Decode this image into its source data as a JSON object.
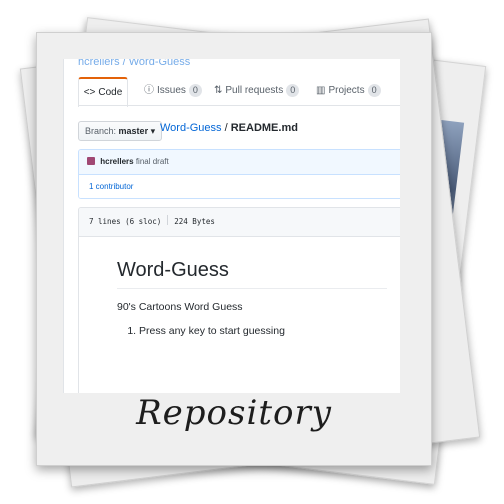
{
  "breadcrumb_top": "hcrellers / Word-Guess",
  "tabs": [
    {
      "icon": "<>",
      "label": "Code"
    },
    {
      "icon": "ⓘ",
      "label": "Issues",
      "count": "0"
    },
    {
      "icon": "⇅",
      "label": "Pull requests",
      "count": "0"
    },
    {
      "icon": "▥",
      "label": "Projects",
      "count": "0"
    }
  ],
  "branch": {
    "label": "Branch:",
    "value": "master",
    "caret": "▾"
  },
  "path": {
    "repo": "Word-Guess",
    "sep": " / ",
    "file": "README.md"
  },
  "commit": {
    "author": "hcrellers",
    "message": "final draft"
  },
  "contributors": "1 contributor",
  "file_info": {
    "lines": "7 lines (6 sloc)",
    "size": "224 Bytes"
  },
  "readme": {
    "title": "Word-Guess",
    "description": "90's Cartoons Word Guess",
    "steps": [
      "Press any key to start guessing"
    ]
  },
  "caption": "Repository",
  "colors": {
    "accent": "#e36209",
    "link": "#0366d6",
    "commit_bg": "#f1f8ff"
  }
}
